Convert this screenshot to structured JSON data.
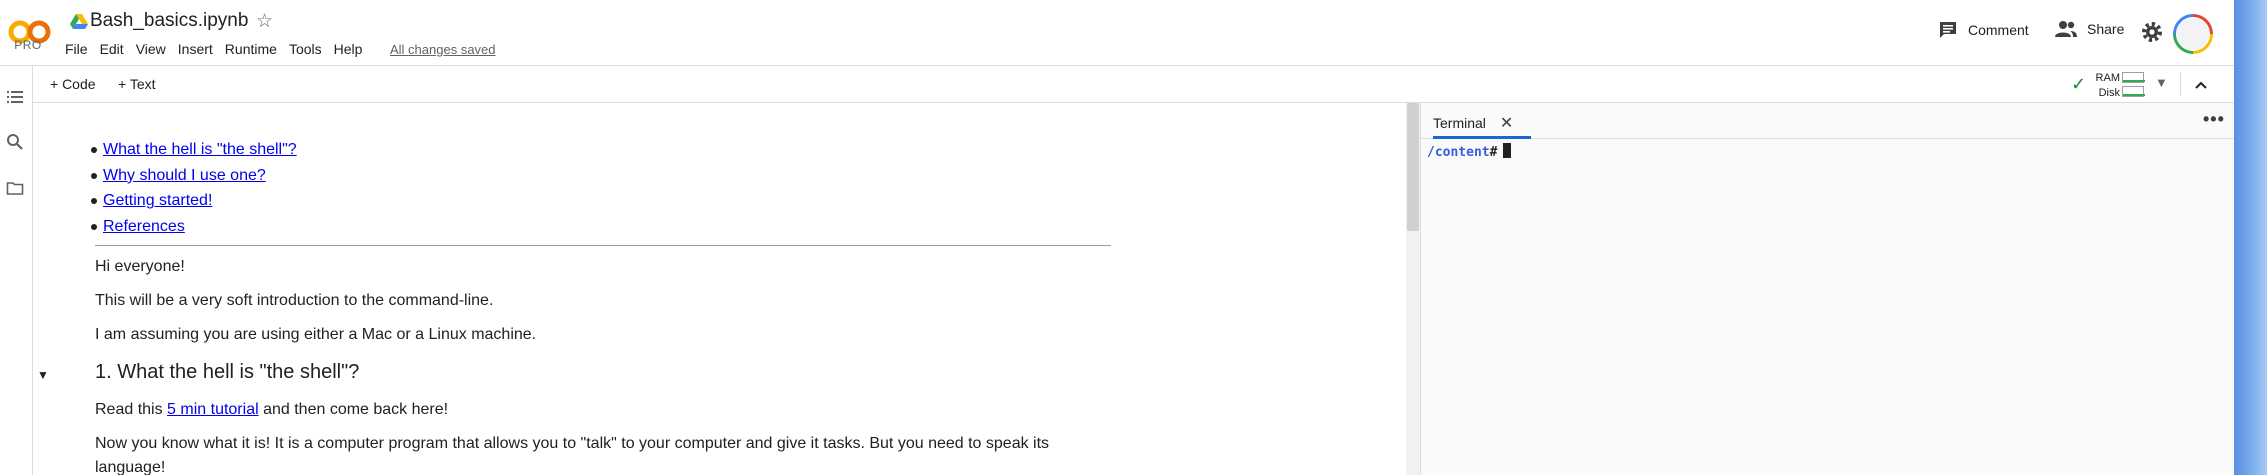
{
  "app": {
    "logo_text": "CO",
    "plan_label": "PRO",
    "notebook_title": "Bash_basics.ipynb",
    "save_status": "All changes saved"
  },
  "menu": [
    "File",
    "Edit",
    "View",
    "Insert",
    "Runtime",
    "Tools",
    "Help"
  ],
  "header_actions": {
    "comment_label": "Comment",
    "share_label": "Share"
  },
  "toolbar": {
    "add_code_label": "+ Code",
    "add_text_label": "+ Text",
    "ram_label": "RAM",
    "disk_label": "Disk"
  },
  "notebook": {
    "toc_links": [
      "What the hell is \"the shell\"?",
      "Why should I use one?",
      "Getting started!",
      "References"
    ],
    "paragraphs": [
      "Hi everyone!",
      "This will be a very soft introduction to the command-line.",
      "I am assuming you are using either a Mac or a Linux machine."
    ],
    "section_heading": "1. What the hell is \"the shell\"?",
    "read_before": "Read this ",
    "read_link": "5 min tutorial",
    "read_after": " and then come back here!",
    "para_line1": "Now you know what it is! It is a computer program that allows you to \"talk\" to your computer and give it tasks. But you need to speak its",
    "para_line2": "language!"
  },
  "terminal": {
    "tab_label": "Terminal",
    "path": "/content",
    "prompt_symbol": "#"
  },
  "colors": {
    "link": "#0000ee",
    "accent": "#1967d2",
    "ok": "#1e8e3e",
    "terminal_path": "#3b5bdb"
  }
}
